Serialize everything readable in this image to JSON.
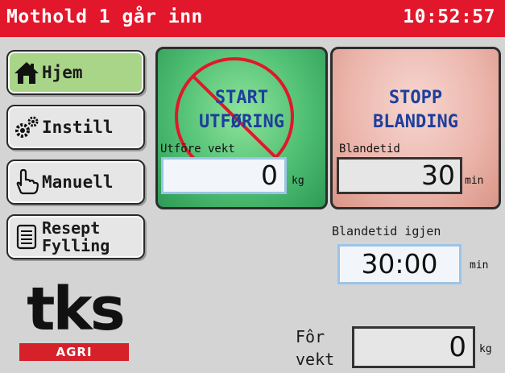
{
  "header": {
    "title": "Mothold 1 går inn",
    "time": "10:52:57"
  },
  "colors": {
    "title_bar": "#e3172b",
    "active_nav": "#a9d588",
    "start_panel": "#4fbf73",
    "stop_panel": "#ebb4aa",
    "big_text": "#1d3f9c",
    "logo_red": "#d6202a"
  },
  "nav": {
    "home": {
      "label": "Hjem",
      "icon": "house-icon"
    },
    "settings": {
      "label": "Instill",
      "icon": "gears-icon"
    },
    "manual": {
      "label": "Manuell",
      "icon": "hand-pointer-icon"
    },
    "recipe": {
      "label_line1": "Resept",
      "label_line2": "Fylling",
      "icon": "document-icon"
    }
  },
  "start_panel": {
    "line1": "START",
    "line2": "UTFØRING",
    "field_label": "Utföre vekt",
    "value": "0",
    "unit": "kg",
    "overlay_icon": "prohibited-icon"
  },
  "stop_panel": {
    "line1": "STOPP",
    "line2": "BLANDING",
    "field_label": "Blandetid",
    "value": "30",
    "unit": "min"
  },
  "remaining": {
    "label": "Blandetid igjen",
    "value": "30:00",
    "unit": "min"
  },
  "feed": {
    "label_line1": "Fôr",
    "label_line2": "vekt",
    "value": "0",
    "unit": "kg"
  },
  "logo": {
    "text": "tks",
    "subtext": "AGRI"
  }
}
